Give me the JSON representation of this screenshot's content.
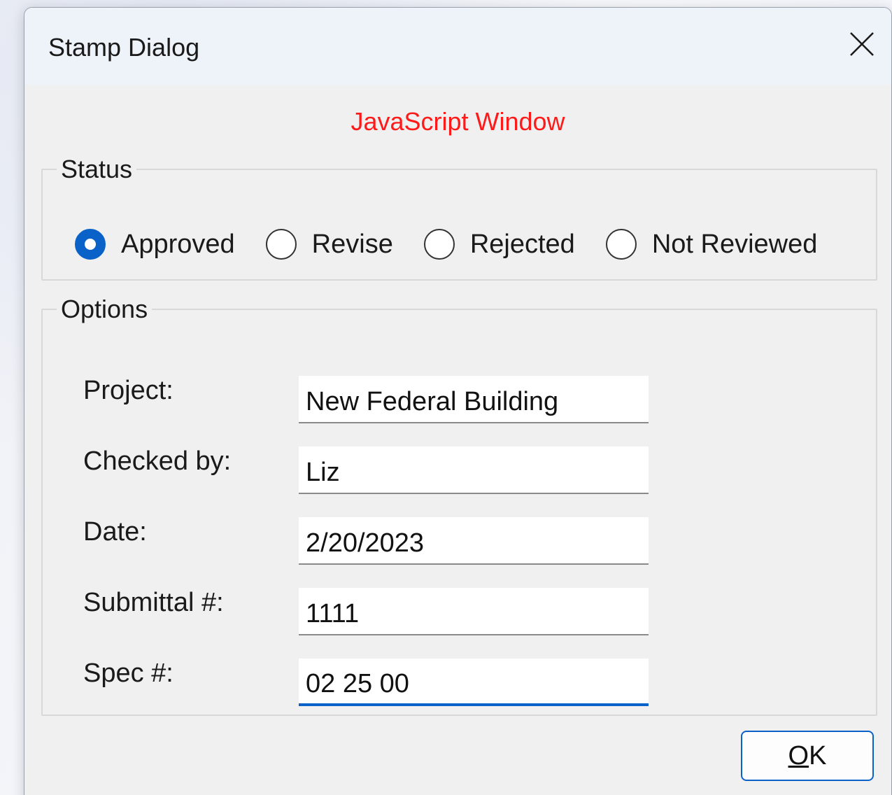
{
  "dialog": {
    "title": "Stamp Dialog",
    "subtitle": "JavaScript Window",
    "subtitle_color": "#ff1a1a"
  },
  "status": {
    "legend": "Status",
    "options": [
      {
        "label": "Approved",
        "checked": true
      },
      {
        "label": "Revise",
        "checked": false
      },
      {
        "label": "Rejected",
        "checked": false
      },
      {
        "label": "Not Reviewed",
        "checked": false
      }
    ]
  },
  "options": {
    "legend": "Options",
    "fields": [
      {
        "label": "Project:",
        "value": "New Federal Building"
      },
      {
        "label": "Checked by:",
        "value": "Liz"
      },
      {
        "label": "Date:",
        "value": "2/20/2023"
      },
      {
        "label": "Submittal #:",
        "value": "1111"
      },
      {
        "label": "Spec #:",
        "value": "02 25 00",
        "focused": true
      }
    ]
  },
  "buttons": {
    "ok_mnemonic": "O",
    "ok_rest": "K"
  },
  "colors": {
    "accent": "#0a62c8"
  },
  "icons": {
    "close": "close-icon"
  }
}
